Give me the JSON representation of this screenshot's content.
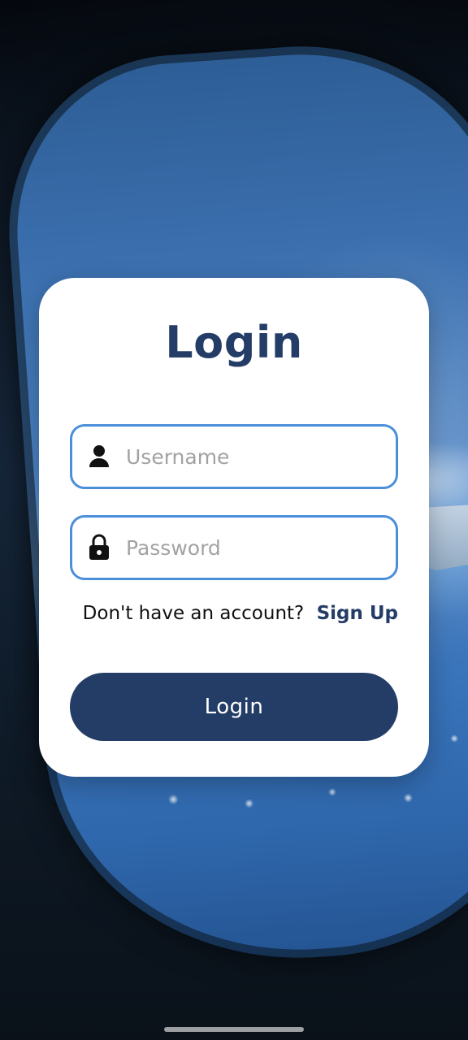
{
  "background": {
    "icon": "airplane-window-background"
  },
  "login_card": {
    "title": "Login",
    "username": {
      "placeholder": "Username",
      "value": "",
      "icon": "person-icon"
    },
    "password": {
      "placeholder": "Password",
      "value": "",
      "icon": "lock-icon"
    },
    "signup_prompt": "Don't have an account?",
    "signup_link": "Sign Up",
    "login_button": "Login"
  },
  "colors": {
    "primary": "#243d66",
    "input_border": "#4b8fda",
    "placeholder": "#a2a2a2",
    "card_background": "#ffffff"
  }
}
